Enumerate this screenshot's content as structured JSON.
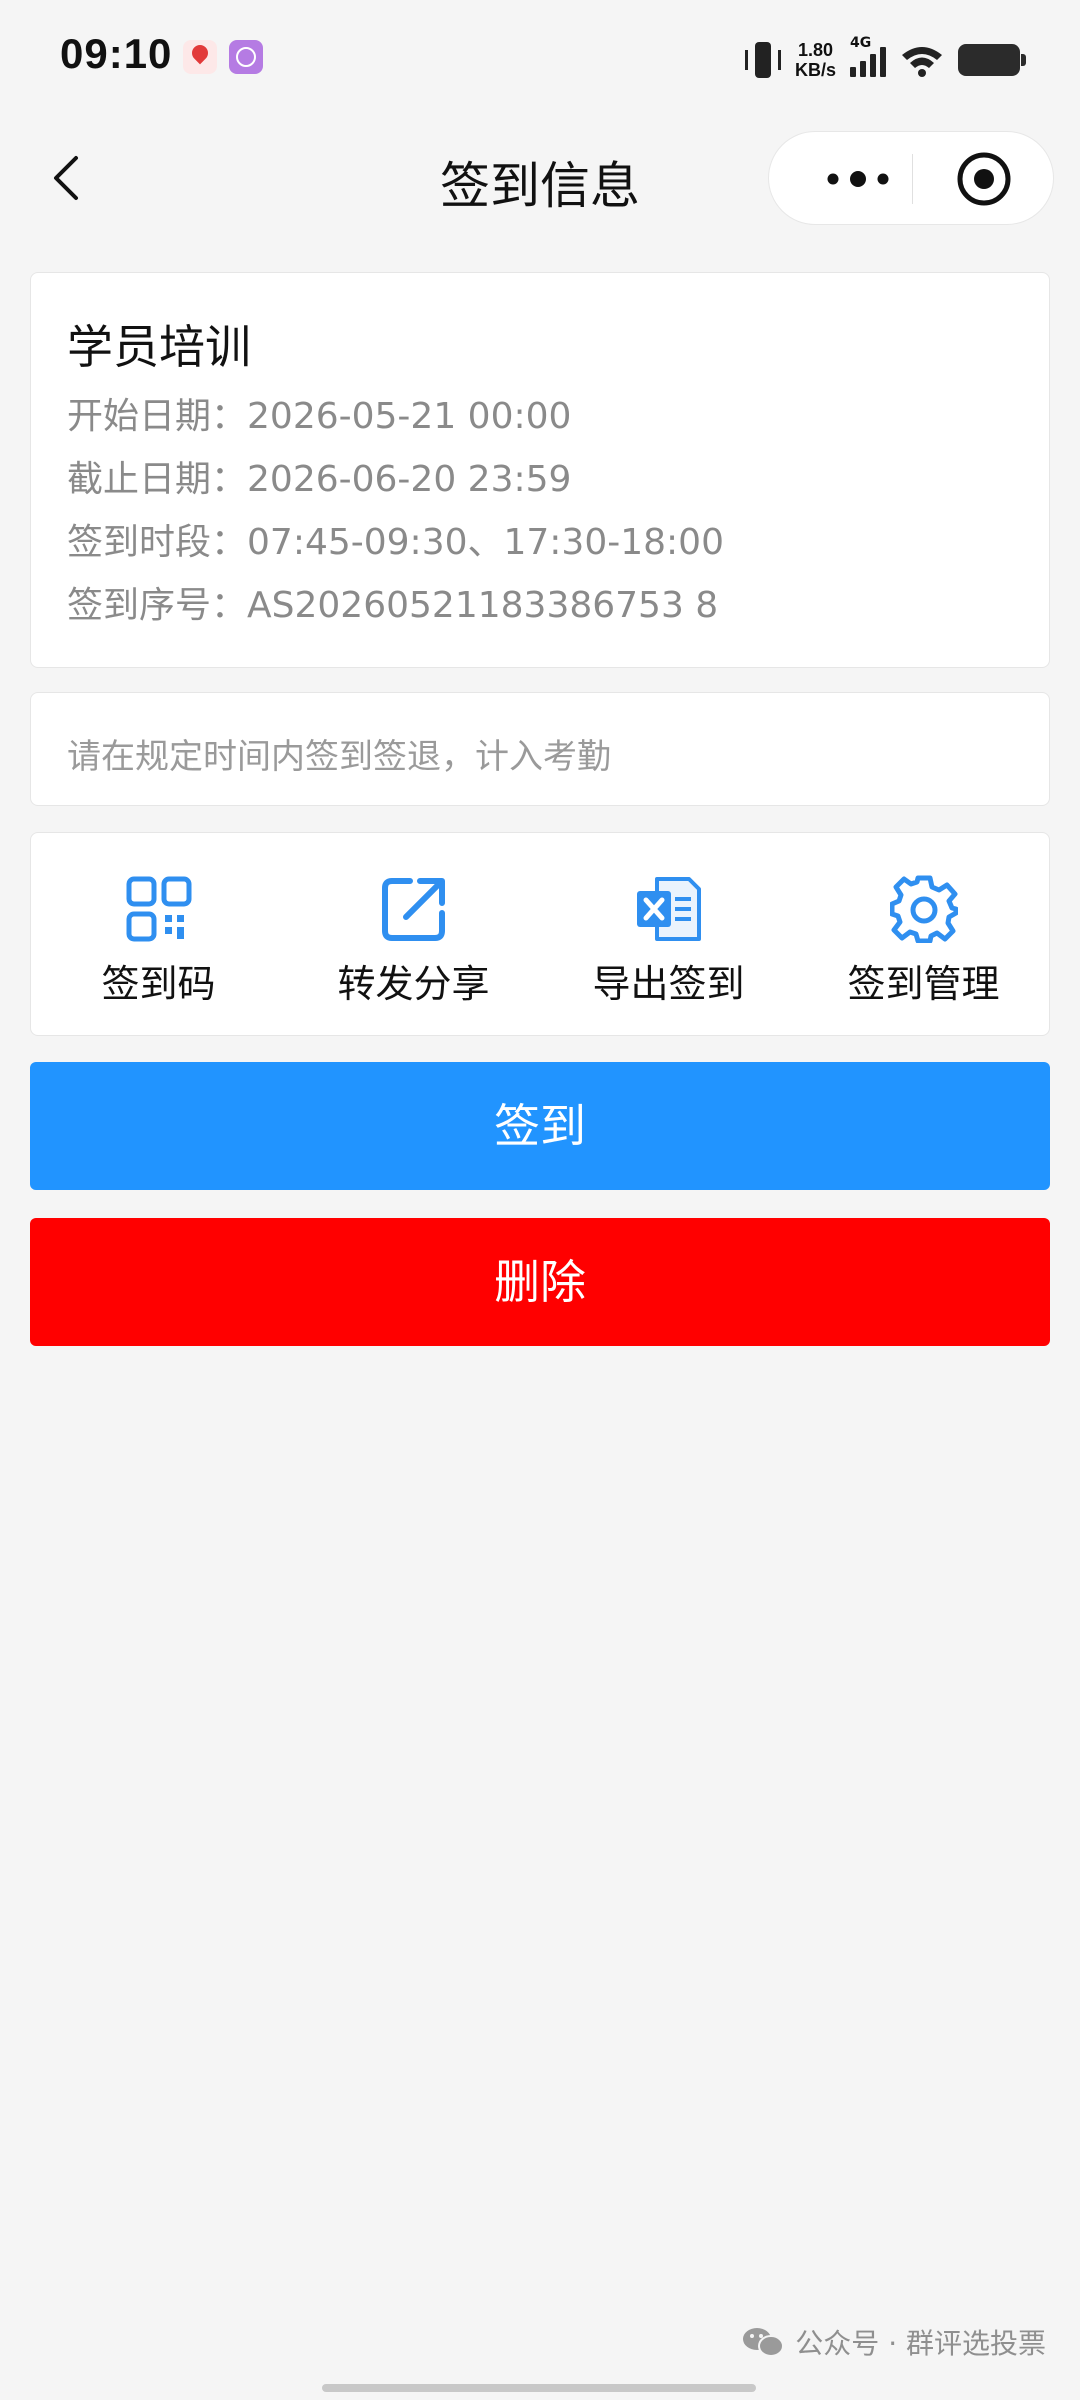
{
  "status_bar": {
    "time": "09:10",
    "net_speed_value": "1.80",
    "net_speed_unit": "KB/s",
    "network_type": "4G",
    "icons": [
      "maps-app-icon",
      "badge-app-icon",
      "vibrate-icon",
      "signal-icon",
      "wifi-icon",
      "battery-icon"
    ]
  },
  "nav": {
    "title": "签到信息",
    "icons": [
      "back-icon",
      "more-icon",
      "close-miniprogram-icon"
    ]
  },
  "event": {
    "title": "学员培训",
    "rows": [
      {
        "label": "开始日期：",
        "value": "2026-05-21 00:00"
      },
      {
        "label": "截止日期：",
        "value": "2026-06-20 23:59"
      },
      {
        "label": "签到时段：",
        "value": "07:45-09:30、17:30-18:00"
      },
      {
        "label": "签到序号：",
        "value": "AS20260521183386753 8"
      }
    ]
  },
  "notice": "请在规定时间内签到签退，计入考勤",
  "actions": [
    {
      "label": "签到码",
      "icon": "qrcode-icon"
    },
    {
      "label": "转发分享",
      "icon": "share-icon"
    },
    {
      "label": "导出签到",
      "icon": "excel-export-icon"
    },
    {
      "label": "签到管理",
      "icon": "gear-icon"
    }
  ],
  "buttons": {
    "signin": "签到",
    "delete": "删除"
  },
  "colors": {
    "primary": "#2194ff",
    "danger": "#ff0000",
    "icon_blue": "#2f8ff0",
    "background": "#f5f5f5"
  },
  "watermark": "公众号 · 群评选投票"
}
